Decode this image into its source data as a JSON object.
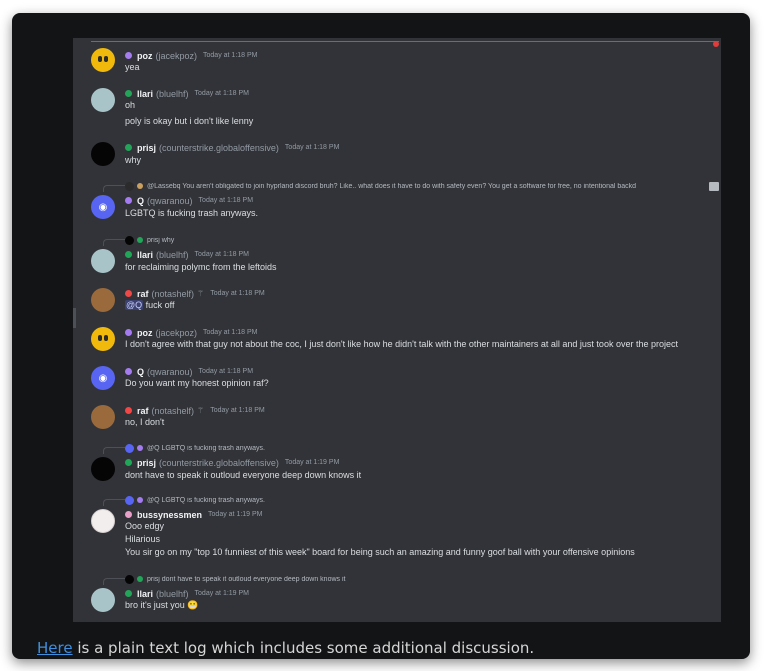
{
  "colors": {
    "online": "#23a559",
    "nitro": "#a47cf0",
    "dnd": "#f04747",
    "pink": "#e7a1c8",
    "link": "#3f8fe0",
    "mention_bg": "#3c4270"
  },
  "messages": [
    {
      "name": "poz",
      "handle": "(jacekpoz)",
      "time": "Today at 1:18 PM",
      "lines": [
        "yea"
      ]
    },
    {
      "name": "Ilari",
      "handle": "(bluelhf)",
      "time": "Today at 1:18 PM",
      "lines": [
        "oh",
        "poly is okay but i don't like lenny"
      ]
    },
    {
      "name": "prisj",
      "handle": "(counterstrike.globaloffensive)",
      "time": "Today at 1:18 PM",
      "lines": [
        "why"
      ]
    },
    {
      "reply": "@Lassebq You aren't obligated to join hyprland discord bruh? Like.. what does it have to do with safety even? You get a software for free, no intentional backd",
      "name": "Q",
      "handle": "(qwaranou)",
      "time": "Today at 1:18 PM",
      "lines": [
        "LGBTQ is fucking trash anyways."
      ]
    },
    {
      "reply": "prisj why",
      "name": "Ilari",
      "handle": "(bluelhf)",
      "time": "Today at 1:18 PM",
      "lines": [
        "for reclaiming polymc from the leftoids"
      ]
    },
    {
      "name": "raf",
      "handle": "(notashelf)",
      "time": "Today at 1:18 PM",
      "mention": "@Q",
      "lines": [
        "fuck off"
      ]
    },
    {
      "name": "poz",
      "handle": "(jacekpoz)",
      "time": "Today at 1:18 PM",
      "lines": [
        "I don't agree with that guy not about the coc, I just don't like how he didn't talk with the other maintainers at all and just took over the project"
      ]
    },
    {
      "name": "Q",
      "handle": "(qwaranou)",
      "time": "Today at 1:18 PM",
      "lines": [
        "Do you want my honest opinion raf?"
      ]
    },
    {
      "name": "raf",
      "handle": "(notashelf)",
      "time": "Today at 1:18 PM",
      "lines": [
        "no, I don't"
      ]
    },
    {
      "reply": "@Q LGBTQ is fucking trash anyways.",
      "name": "prisj",
      "handle": "(counterstrike.globaloffensive)",
      "time": "Today at 1:19 PM",
      "lines": [
        "dont have to speak it outloud everyone deep down knows it"
      ]
    },
    {
      "reply": "@Q LGBTQ is fucking trash anyways.",
      "name": "bussynessmen",
      "handle": "",
      "time": "Today at 1:19 PM",
      "lines": [
        "Ooo edgy",
        "Hilarious",
        "You sir go on my \"top 10 funniest of this week\" board for being such an amazing and funny goof ball with your offensive opinions"
      ]
    },
    {
      "reply": "prisj dont have to speak it outloud everyone deep down knows it",
      "name": "Ilari",
      "handle": "(bluelhf)",
      "time": "Today at 1:19 PM",
      "lines": [
        "bro it's just you",
        "😬"
      ]
    }
  ],
  "caption": {
    "link": "Here",
    "text": " is a plain text log which includes some additional discussion."
  }
}
